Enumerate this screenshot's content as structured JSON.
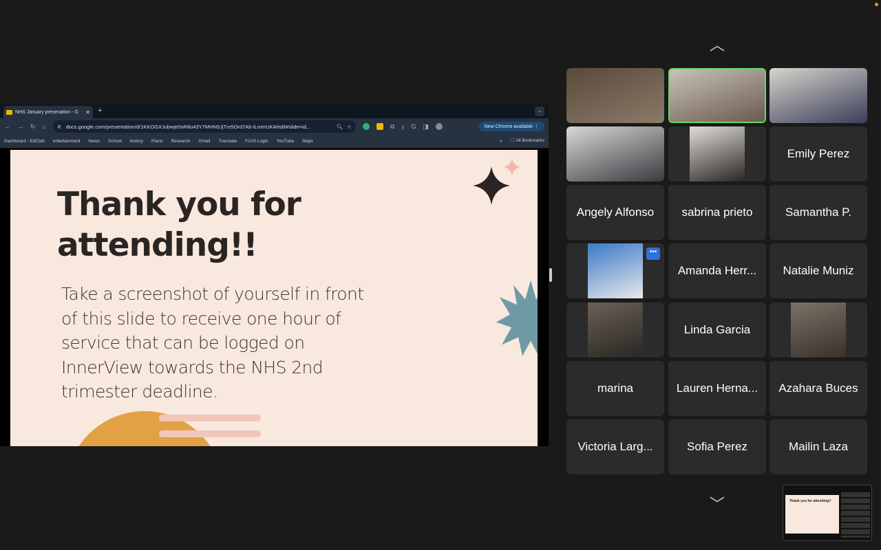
{
  "browser": {
    "tab_title": "NHS January presenation - G",
    "url": "docs.google.com/presentation/d/1KKOGXJubwje0nR8u43Y7MHN5JjTm5Ord7Ab-iLmmUK4/edit#slide=id...",
    "new_chrome_label": "New Chrome available",
    "bookmarks": [
      "Dashboard - EdClub",
      "entertainment",
      "News",
      "School",
      "history",
      "Piano",
      "Research",
      "Gmail",
      "Translate",
      "FLVS Login",
      "YouTube",
      "Maps"
    ],
    "all_bookmarks": "All Bookmarks"
  },
  "slide": {
    "title": "Thank you for attending!!",
    "body": "Take a screenshot of yourself in front of this slide to receive one hour of service that can be logged on InnerView towards the NHS 2nd trimester deadline."
  },
  "participants": [
    {
      "name": "",
      "video": true,
      "colors": [
        "#5a4a3a",
        "#8a7a68"
      ]
    },
    {
      "name": "",
      "video": true,
      "active": true,
      "colors": [
        "#c8c2b8",
        "#6a5a50"
      ]
    },
    {
      "name": "",
      "video": true,
      "colors": [
        "#d8d4cc",
        "#3a3e5a"
      ]
    },
    {
      "name": "",
      "video": true,
      "colors": [
        "#d8d8d6",
        "#3a3a40"
      ]
    },
    {
      "name": "",
      "video": true,
      "narrow": true,
      "colors": [
        "#e0ddd8",
        "#2a2522"
      ]
    },
    {
      "name": "Emily Perez"
    },
    {
      "name": "Angely Alfonso"
    },
    {
      "name": "sabrina prieto"
    },
    {
      "name": "Samantha P."
    },
    {
      "name": "",
      "video": true,
      "narrow": true,
      "more": "•••",
      "colors": [
        "#3a7ac8",
        "#e8e8ea"
      ]
    },
    {
      "name": "Amanda Herr..."
    },
    {
      "name": "Natalie Muniz"
    },
    {
      "name": "",
      "video": true,
      "narrow": true,
      "colors": [
        "#6a6058",
        "#2a2622"
      ]
    },
    {
      "name": "Linda Garcia"
    },
    {
      "name": "",
      "video": true,
      "narrow": true,
      "colors": [
        "#7a7468",
        "#3a302a"
      ]
    },
    {
      "name": "marina"
    },
    {
      "name": "Lauren Herna..."
    },
    {
      "name": "Azahara Buces"
    },
    {
      "name": "Victoria Larg..."
    },
    {
      "name": "Sofia Perez"
    },
    {
      "name": "Mailin Laza"
    }
  ],
  "thumbnail": {
    "title": "Thank you for attending!!"
  }
}
